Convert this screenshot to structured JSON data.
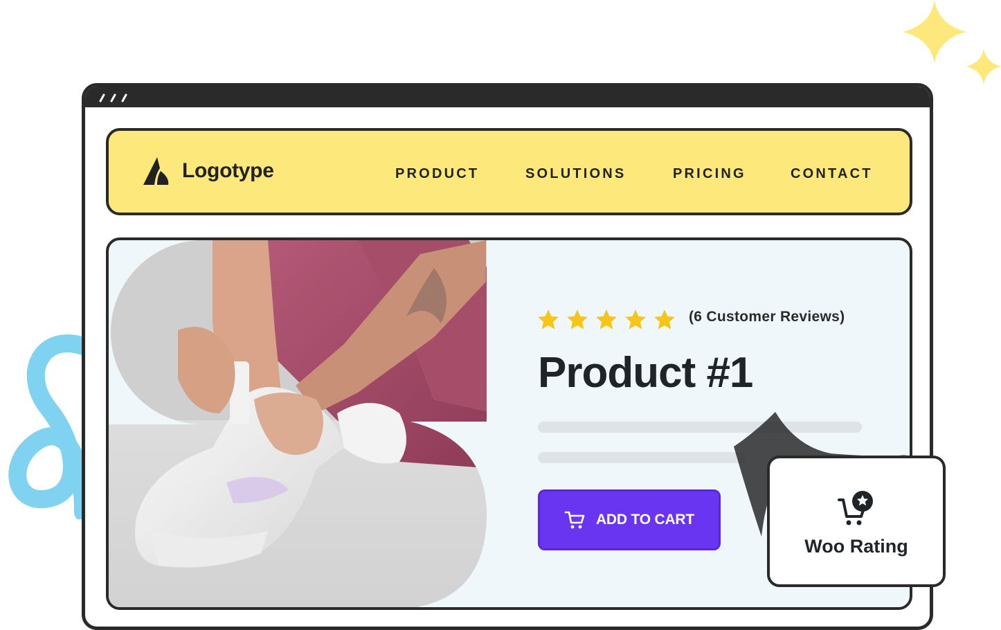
{
  "brand": {
    "name": "Logotype"
  },
  "nav": {
    "items": [
      {
        "label": "PRODUCT"
      },
      {
        "label": "SOLUTIONS"
      },
      {
        "label": "PRICING"
      },
      {
        "label": "CONTACT"
      }
    ]
  },
  "product": {
    "rating": 5,
    "reviews_text": "(6 Customer Reviews)",
    "title": "Product #1",
    "cta_label": "ADD TO CART"
  },
  "badge": {
    "label": "Woo Rating"
  },
  "colors": {
    "nav_bg": "#fde97b",
    "frame": "#2a2a2a",
    "card_bg": "#eff7fb",
    "star": "#f5c518",
    "cta": "#6a35f0",
    "sparkle": "#fde97b",
    "squiggle": "#7fd3f0"
  },
  "icons": {
    "logo": "logo-mark-icon",
    "star": "star-icon",
    "cart": "cart-icon",
    "woo": "cart-star-icon"
  }
}
